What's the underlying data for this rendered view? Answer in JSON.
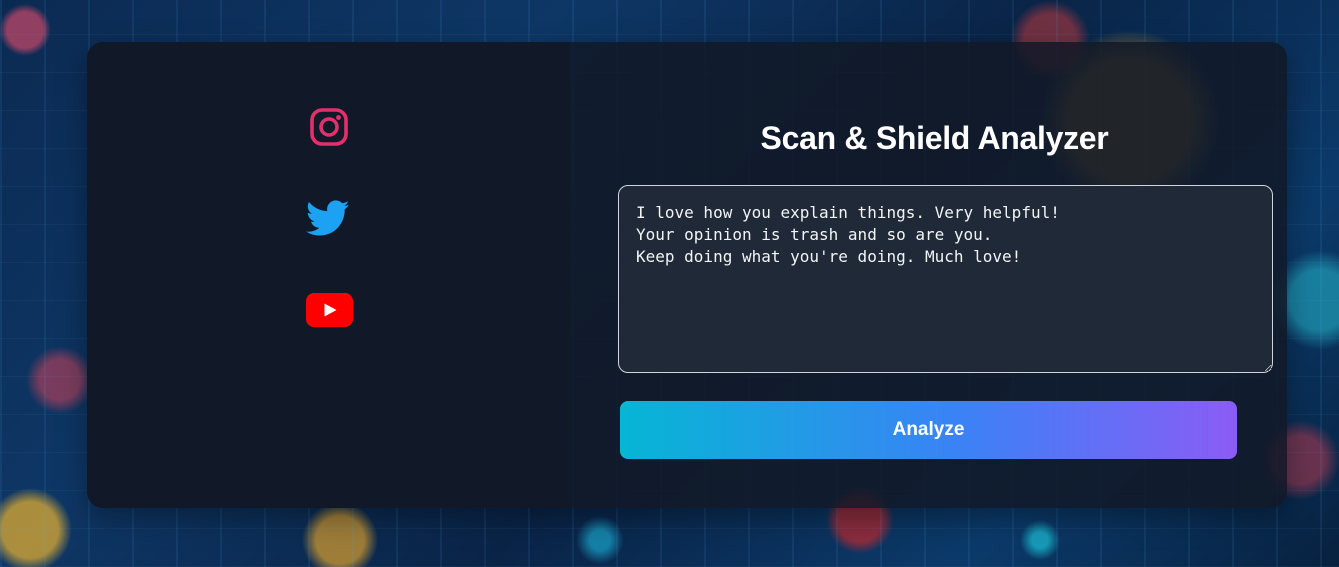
{
  "app": {
    "title": "Scan & Shield Analyzer"
  },
  "social": [
    {
      "name": "instagram-icon",
      "color": "#e1306c"
    },
    {
      "name": "twitter-icon",
      "color": "#1da1f2"
    },
    {
      "name": "youtube-icon",
      "color": "#ff0000"
    }
  ],
  "analyzer": {
    "input_value": "I love how you explain things. Very helpful!\nYour opinion is trash and so are you.\nKeep doing what you're doing. Much love!",
    "button_label": "Analyze"
  },
  "colors": {
    "panel_bg": "#111827",
    "input_bg": "#1f2937",
    "button_gradient_start": "#06b6d4",
    "button_gradient_end": "#8b5cf6"
  }
}
